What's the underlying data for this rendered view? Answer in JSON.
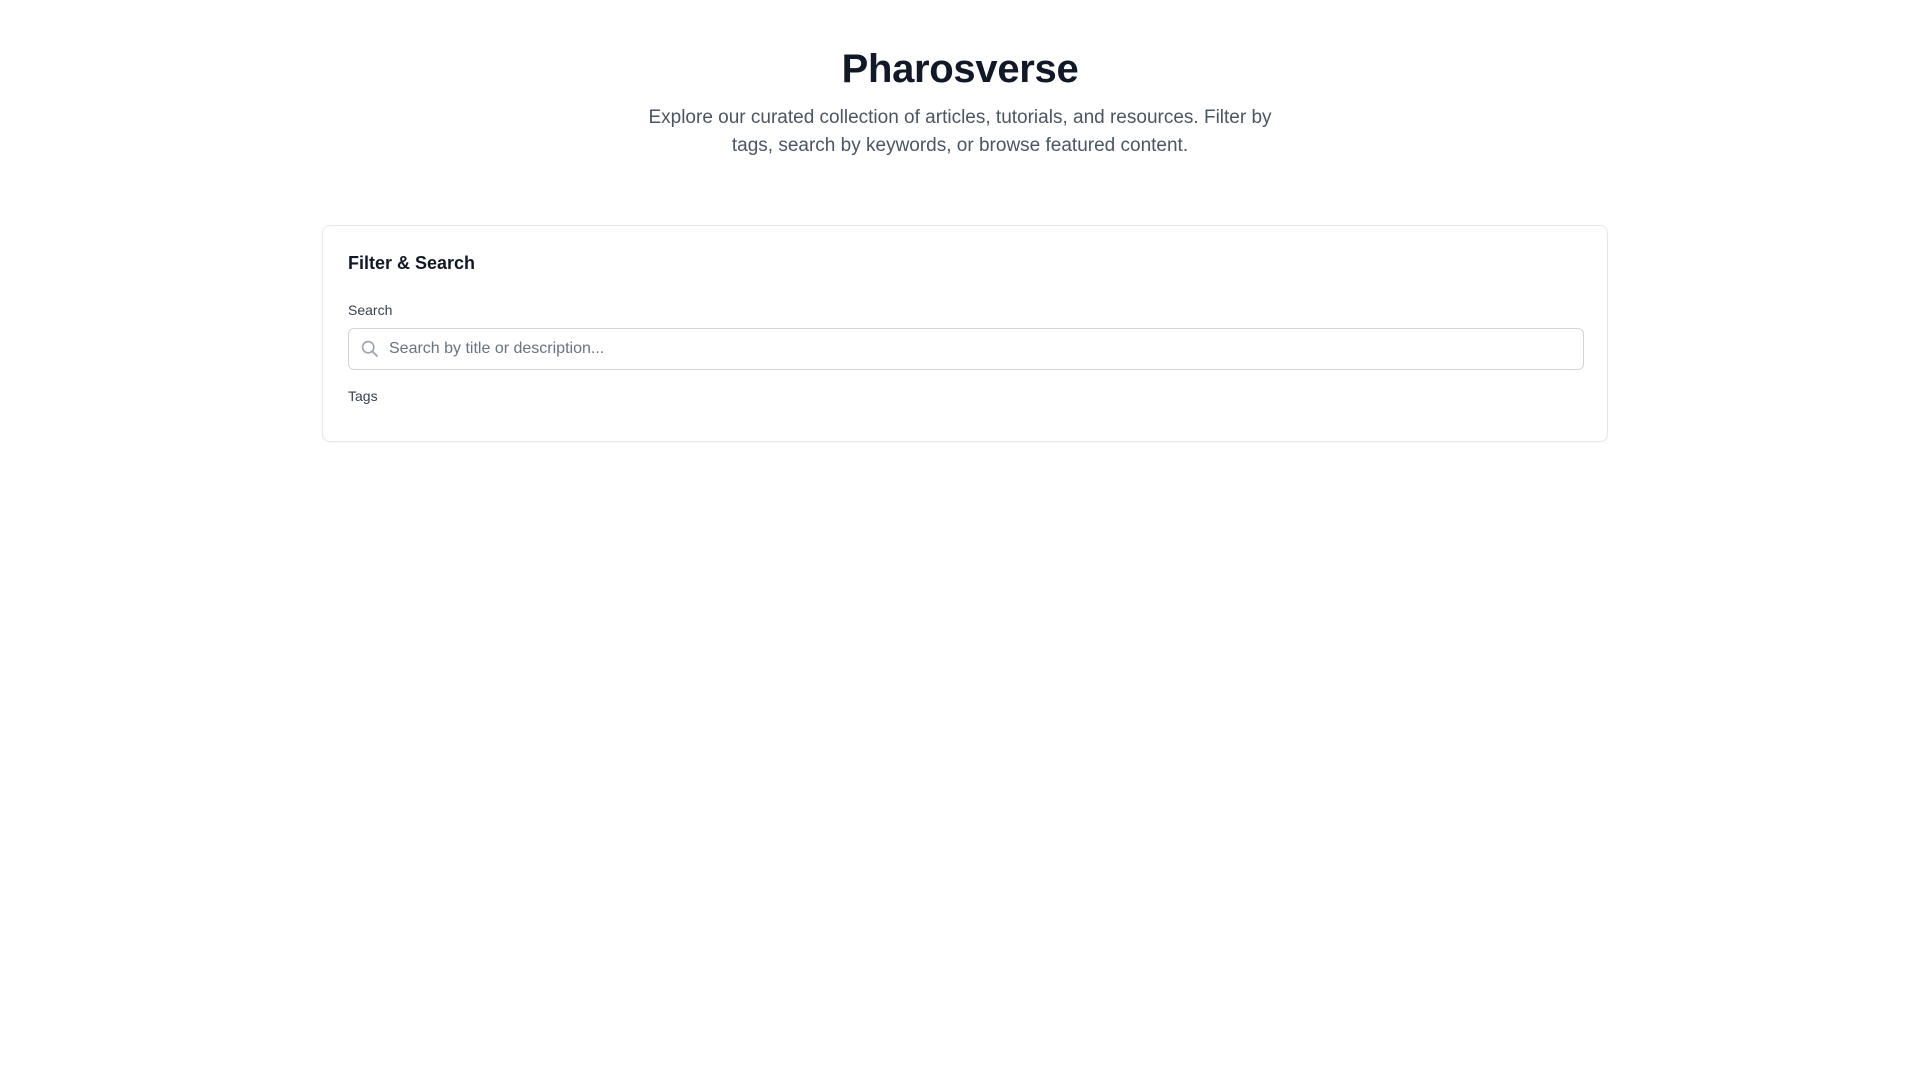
{
  "hero": {
    "title": "Pharosverse",
    "subtitle": "Explore our curated collection of articles, tutorials, and resources. Filter by tags, search by keywords, or browse featured content."
  },
  "filter": {
    "title": "Filter & Search",
    "search_label": "Search",
    "search_placeholder": "Search by title or description...",
    "search_value": "",
    "search_icon": "search-icon",
    "tags_label": "Tags"
  }
}
